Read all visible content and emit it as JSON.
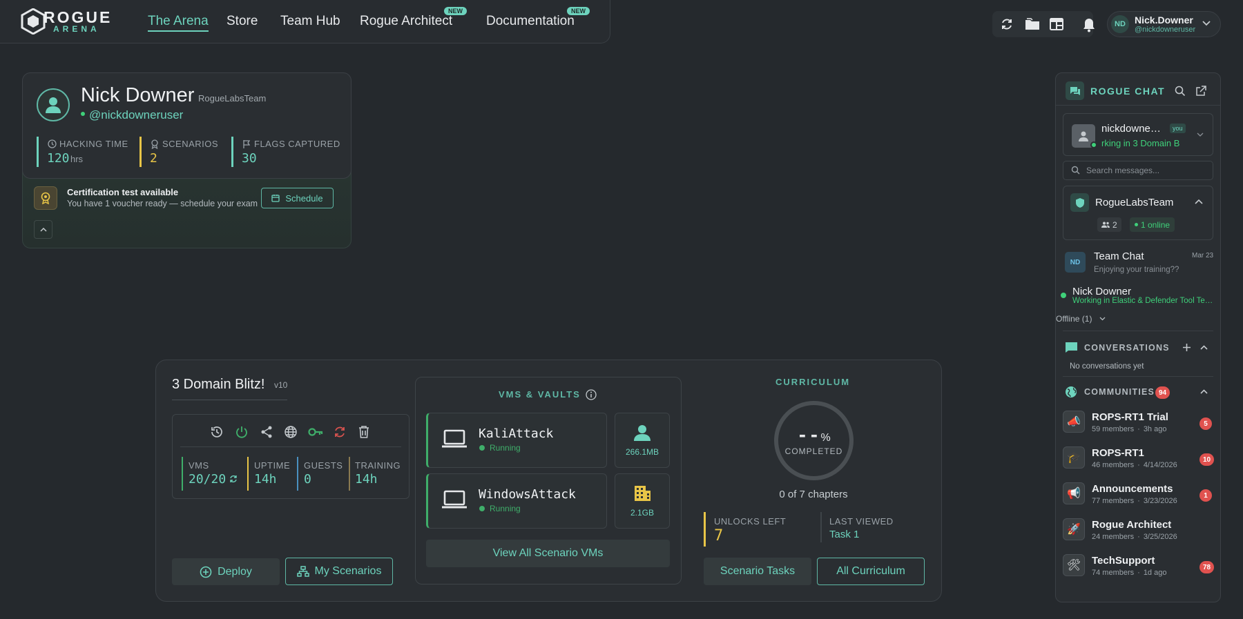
{
  "brand": {
    "main": "ROGUE",
    "sub": "ARENA"
  },
  "nav": {
    "items": [
      "The Arena",
      "Store",
      "Team Hub",
      "Rogue Architect",
      "Documentation"
    ],
    "new_badge": "NEW"
  },
  "user": {
    "initials": "ND",
    "name": "Nick.Downer",
    "handle": "@nickdowneruser"
  },
  "profile": {
    "name": "Nick Downer",
    "team": "RogueLabsTeam",
    "handle": "@nickdowneruser",
    "stats": [
      {
        "label": "HACKING TIME",
        "value": "120",
        "unit": "hrs",
        "color": "#6dd3bd"
      },
      {
        "label": "SCENARIOS",
        "value": "2",
        "unit": "",
        "color": "#e8c547"
      },
      {
        "label": "FLAGS CAPTURED",
        "value": "30",
        "unit": "",
        "color": "#6dd3bd"
      }
    ]
  },
  "cert": {
    "title": "Certification test available",
    "desc": "You have 1 voucher ready — schedule your exam",
    "button": "Schedule"
  },
  "scenario": {
    "title": "3 Domain Blitz!",
    "version": "v10",
    "stats": [
      {
        "label": "VMS",
        "value": "20/20",
        "color": "#3fae6a"
      },
      {
        "label": "UPTIME",
        "value": "14h",
        "color": "#e8c547"
      },
      {
        "label": "GUESTS",
        "value": "0",
        "color": "#4a90c0"
      },
      {
        "label": "TRAINING",
        "value": "14h",
        "color": "#8a7a50"
      }
    ],
    "deploy_label": "Deploy",
    "my_scenarios_label": "My Scenarios"
  },
  "vms": {
    "title": "VMS & VAULTS",
    "items": [
      {
        "name": "KaliAttack",
        "status": "Running",
        "stat": "266.1MB"
      },
      {
        "name": "WindowsAttack",
        "status": "Running",
        "stat": "2.1GB"
      }
    ],
    "view_all": "View All Scenario VMs"
  },
  "curriculum": {
    "title": "CURRICULUM",
    "percent": "--",
    "percent_sign": "%",
    "completed_label": "COMPLETED",
    "chapters": "0 of 7 chapters",
    "unlocks_label": "UNLOCKS LEFT",
    "unlocks_value": "7",
    "last_viewed_label": "LAST VIEWED",
    "last_viewed_value": "Task 1",
    "tasks_button": "Scenario Tasks",
    "all_button": "All Curriculum"
  },
  "chat": {
    "title": "ROGUE CHAT",
    "me": {
      "name": "nickdowne…",
      "tag": "you",
      "status": "rking in 3 Domain B"
    },
    "search_placeholder": "Search messages...",
    "team": {
      "name": "RogueLabsTeam",
      "members": "2",
      "online": "1 online"
    },
    "team_chat": {
      "initials": "ND",
      "name": "Team Chat",
      "date": "Mar 23",
      "preview": "Enjoying your training??"
    },
    "member": {
      "name": "Nick Downer",
      "status": "Working in Elastic & Defender Tool Te…"
    },
    "offline": "Offline (1)",
    "conversations": {
      "title": "CONVERSATIONS",
      "empty": "No conversations yet"
    },
    "communities": {
      "title": "COMMUNITIES",
      "count": "94",
      "items": [
        {
          "name": "ROPS-RT1 Trial",
          "members": "59 members",
          "time": "3h ago",
          "badge": "5",
          "icon": "megaphone-icon",
          "glyph": "📣"
        },
        {
          "name": "ROPS-RT1",
          "members": "46 members",
          "time": "4/14/2026",
          "badge": "10",
          "icon": "graduation-cap-icon",
          "glyph": "🎓"
        },
        {
          "name": "Announcements",
          "members": "77 members",
          "time": "3/23/2026",
          "badge": "1",
          "icon": "announcement-icon",
          "glyph": "📢"
        },
        {
          "name": "Rogue Architect",
          "members": "24 members",
          "time": "3/25/2026",
          "badge": "",
          "icon": "rocket-icon",
          "glyph": "🚀"
        },
        {
          "name": "TechSupport",
          "members": "74 members",
          "time": "1d ago",
          "badge": "78",
          "icon": "tools-icon",
          "glyph": "🛠"
        }
      ]
    }
  }
}
